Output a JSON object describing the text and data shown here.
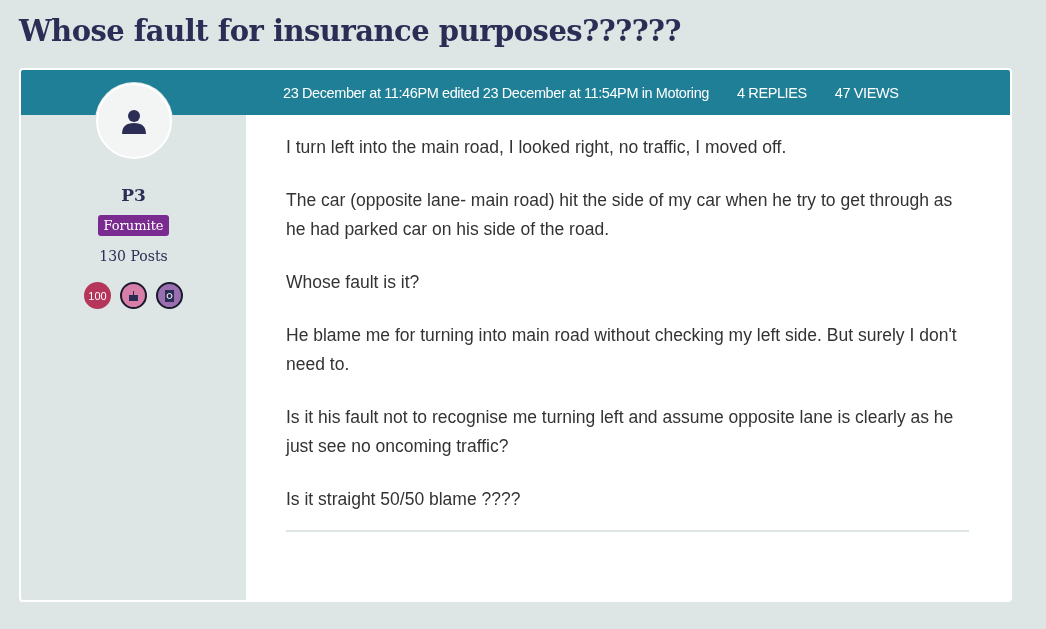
{
  "title": "Whose fault for insurance purposes??????",
  "meta": {
    "posted": "23 December at 11:46PM edited 23 December at 11:54PM in Motoring",
    "replies": "4 REPLIES",
    "views": "47 VIEWS"
  },
  "author": {
    "name": "P3",
    "rank": "Forumite",
    "posts": "130 Posts",
    "badges": [
      {
        "kind": "count",
        "label": "100",
        "color": "#b5365a"
      },
      {
        "kind": "cake",
        "color": "#d77fa8"
      },
      {
        "kind": "book",
        "color": "#9a6fb0"
      }
    ]
  },
  "paragraphs": [
    "I turn left into the main road, I looked right, no traffic, I moved off.",
    "The car (opposite lane- main road) hit the side of my car when he try to get through as he had parked car on his side of the road.",
    "Whose fault is it?",
    "He blame me for turning into main road without checking my left side. But surely I don't need to.",
    "Is it his fault not to recognise me turning left and assume opposite lane is clearly as he just see no oncoming traffic?",
    "Is it straight 50/50 blame ????"
  ]
}
